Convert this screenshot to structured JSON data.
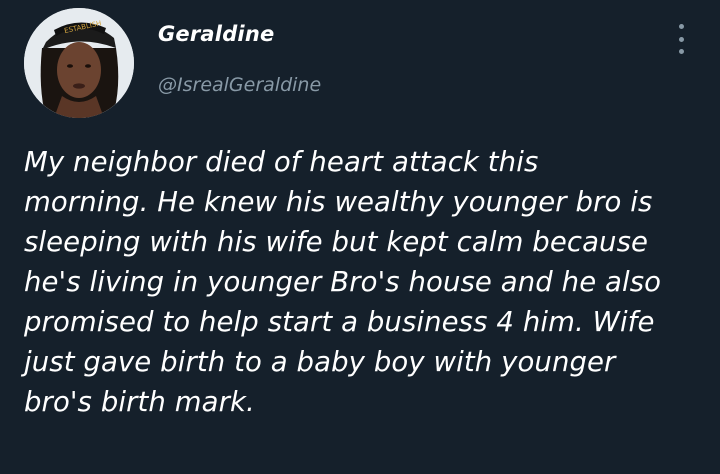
{
  "author": {
    "display_name": "Geraldine",
    "handle": "@IsrealGeraldine",
    "avatar_icon": "profile-photo"
  },
  "menu": {
    "more_icon": "vertical-ellipsis-icon"
  },
  "tweet": {
    "lines": [
      "My neighbor died of heart attack this",
      "morning. He knew his wealthy younger bro is",
      "sleeping with his wife but kept calm because",
      "he's living in younger Bro's house and he also",
      "promised to help start a business 4 him. Wife",
      "just gave birth to a baby boy with younger",
      "bro's birth mark."
    ]
  },
  "colors": {
    "background": "#15202b",
    "primary_text": "#ffffff",
    "secondary_text": "#8899a6"
  }
}
